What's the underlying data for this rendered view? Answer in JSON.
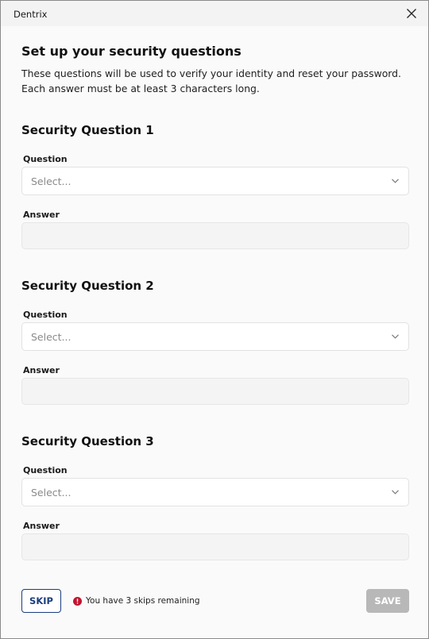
{
  "window": {
    "title": "Dentrix"
  },
  "header": {
    "title": "Set up your security questions",
    "description_line1": "These questions will be used to verify your identity and reset your password.",
    "description_line2": "Each answer must be at least 3 characters long."
  },
  "questions": [
    {
      "heading": "Security Question 1",
      "question_label": "Question",
      "select_placeholder": "Select...",
      "answer_label": "Answer",
      "answer_value": ""
    },
    {
      "heading": "Security Question 2",
      "question_label": "Question",
      "select_placeholder": "Select...",
      "answer_label": "Answer",
      "answer_value": ""
    },
    {
      "heading": "Security Question 3",
      "question_label": "Question",
      "select_placeholder": "Select...",
      "answer_label": "Answer",
      "answer_value": ""
    }
  ],
  "footer": {
    "skip_label": "SKIP",
    "skip_note": "You have 3 skips remaining",
    "save_label": "SAVE",
    "save_enabled": false
  },
  "icons": {
    "close": "close-icon",
    "chevron": "chevron-down-icon",
    "alert": "alert-circle-icon"
  },
  "colors": {
    "primary": "#1a3d7c",
    "disabled_button": "#b8b8b8",
    "alert": "#c4122f"
  }
}
